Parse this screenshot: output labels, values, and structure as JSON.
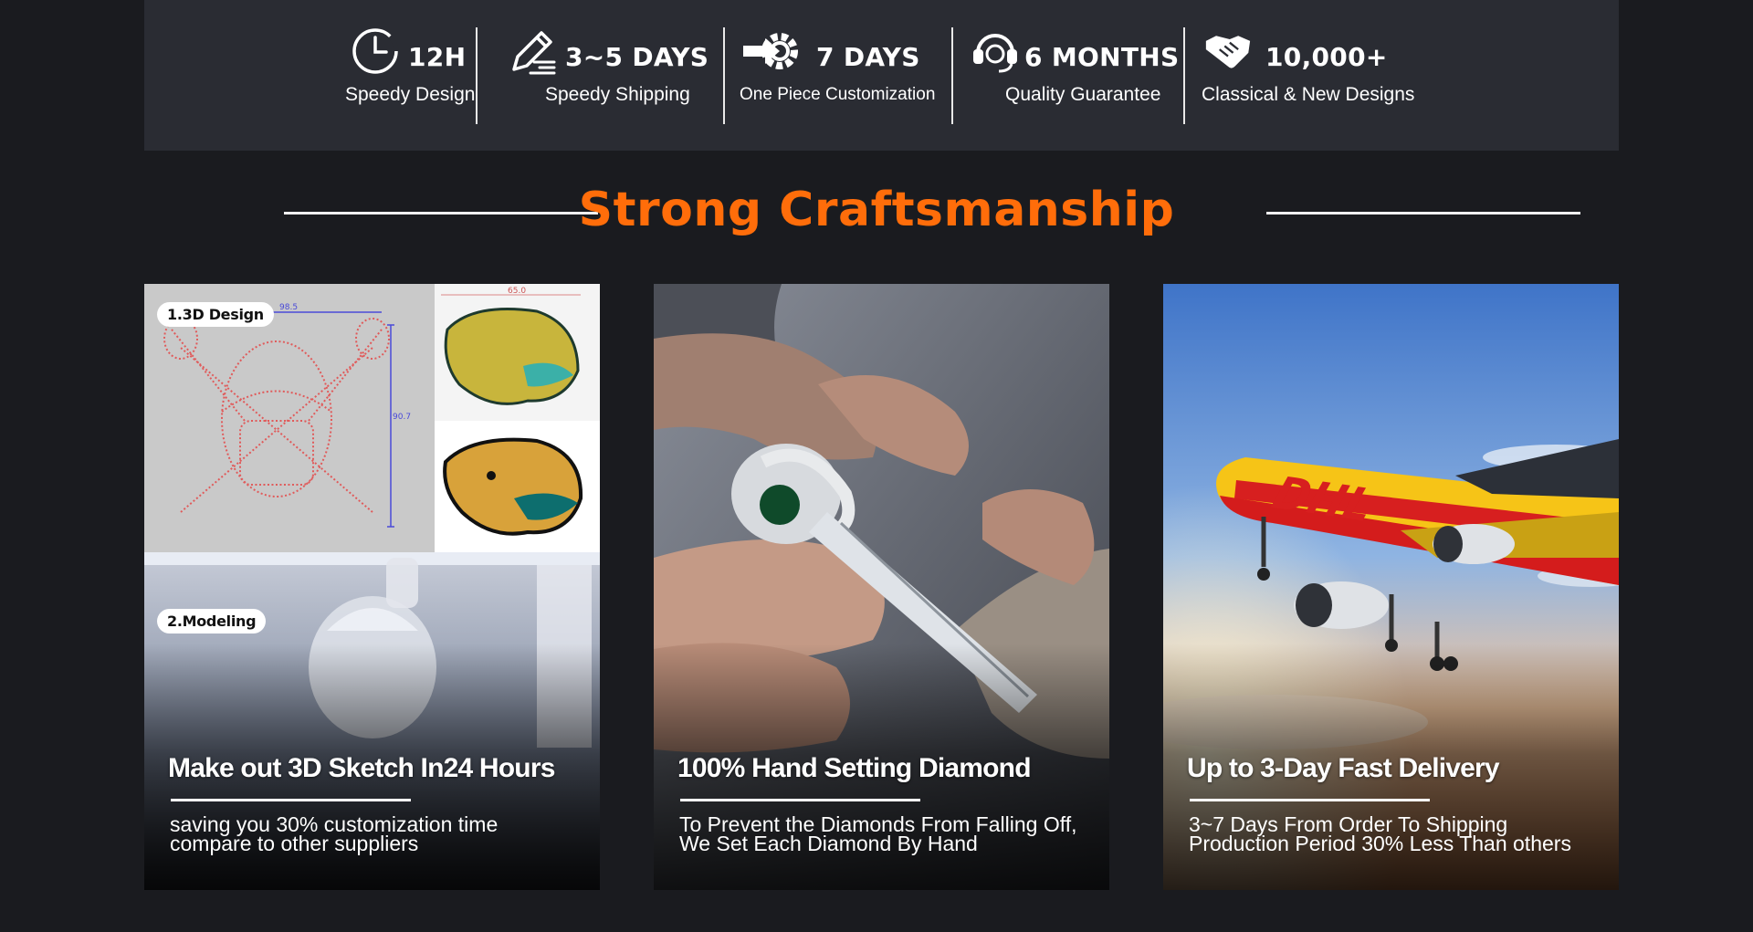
{
  "features": [
    {
      "icon": "clock-icon",
      "title": "12H",
      "subtitle": "Speedy Design"
    },
    {
      "icon": "pencil-icon",
      "title": "3~5 DAYS",
      "subtitle": "Speedy Shipping"
    },
    {
      "icon": "gear-arrow-icon",
      "title": "7 DAYS",
      "subtitle": "One Piece Customization"
    },
    {
      "icon": "headset-icon",
      "title": "6 MONTHS",
      "subtitle": "Quality Guarantee"
    },
    {
      "icon": "handshake-icon",
      "title": "10,000+",
      "subtitle": "Classical & New Designs"
    }
  ],
  "section": {
    "heading": "Strong Craftsmanship",
    "accent_color": "#ff6d0a"
  },
  "cards": [
    {
      "title": "Make out 3D Sketch In24 Hours",
      "desc_line1": "saving you 30% customization time",
      "desc_line2": "compare to other suppliers",
      "badges": [
        "1.3D Design",
        "2.Modeling"
      ],
      "drawing_labels": {
        "width": "98.5",
        "height": "90.7",
        "top": "65.0"
      }
    },
    {
      "title": "100% Hand Setting Diamond",
      "desc_line1": "To Prevent the Diamonds From Falling Off,",
      "desc_line2": "We Set Each Diamond By Hand"
    },
    {
      "title": "Up to 3-Day Fast Delivery",
      "desc_line1": "3~7 Days From Order To Shipping",
      "desc_line2": "Production Period 30% Less Than others",
      "plane_livery": "DHL"
    }
  ]
}
